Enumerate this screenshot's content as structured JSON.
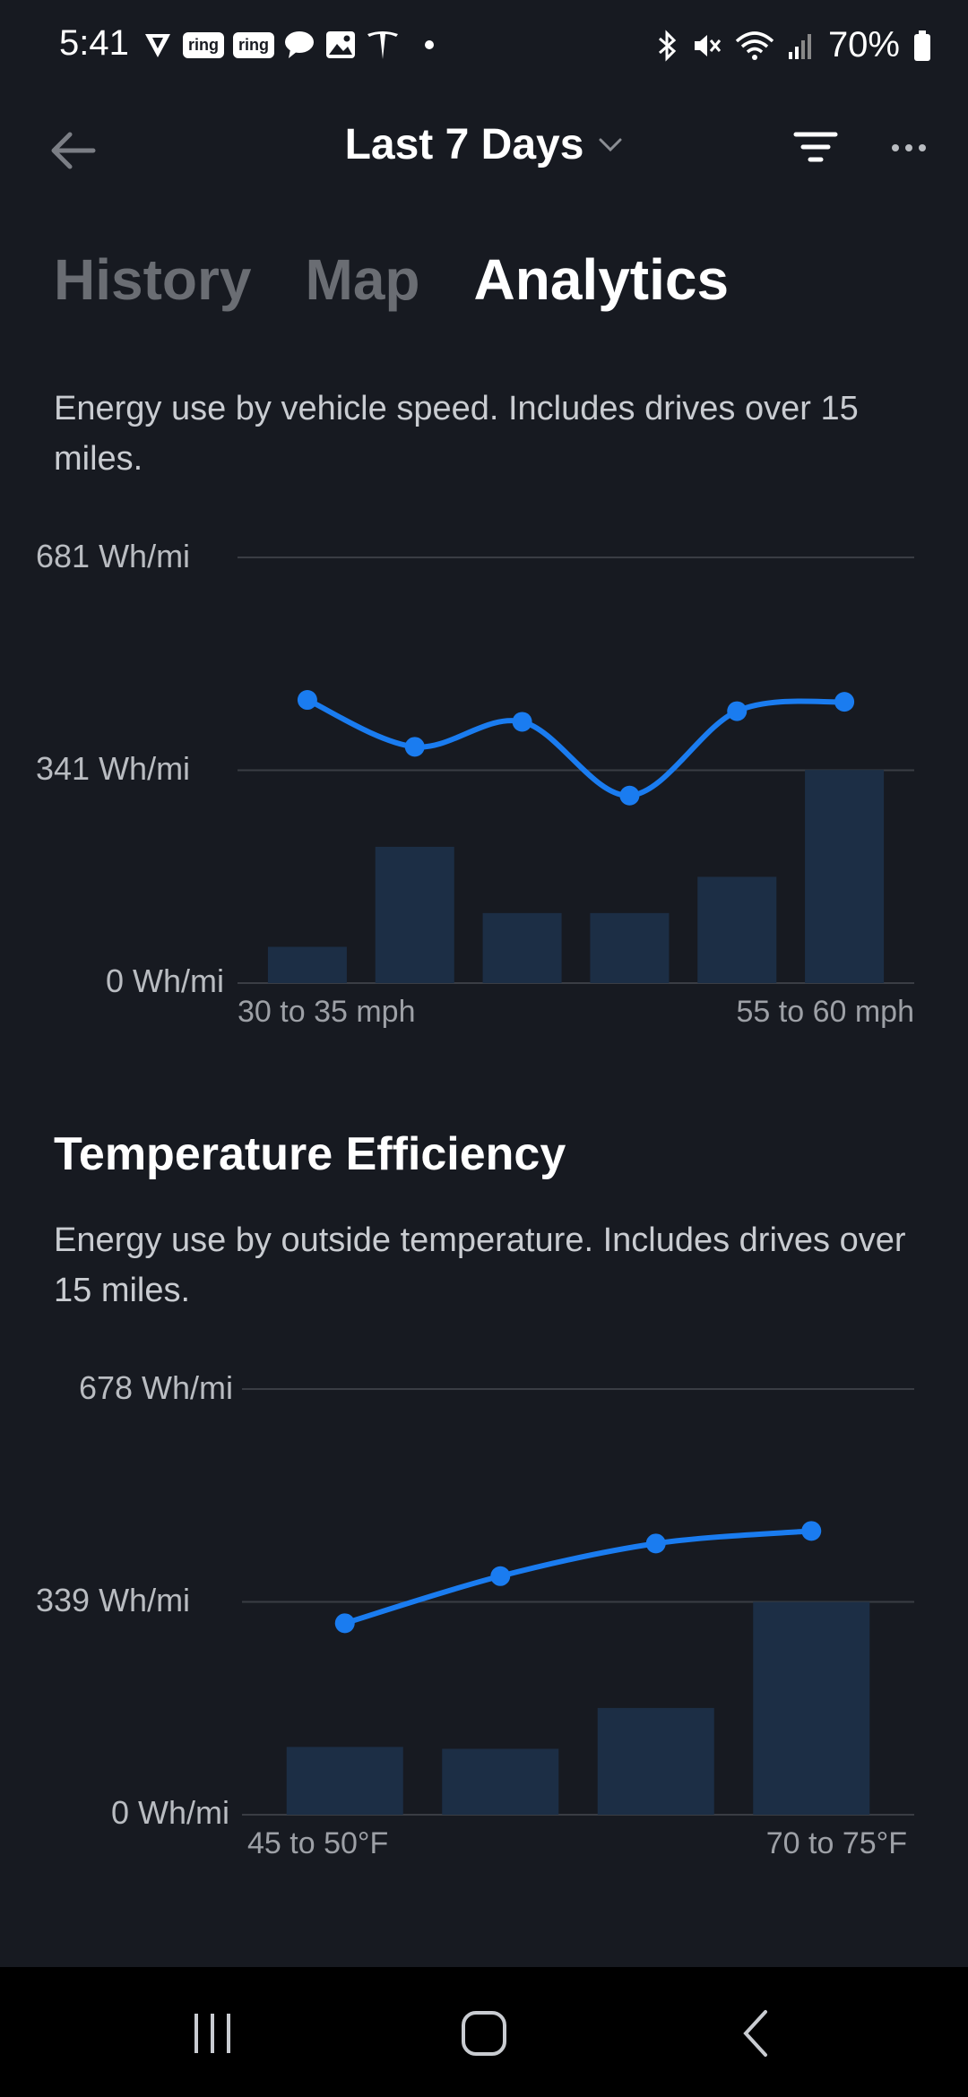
{
  "status_bar": {
    "time": "5:41",
    "left_icons": [
      "pinwheel-icon",
      "ring-icon",
      "ring-icon",
      "chat-bubble-icon",
      "image-icon",
      "tesla-icon"
    ],
    "ring_label": "ring",
    "battery": "70%",
    "right_icons": [
      "bluetooth-icon",
      "mute-icon",
      "wifi-icon",
      "signal-icon",
      "battery-icon"
    ]
  },
  "header": {
    "range_label": "Last 7 Days"
  },
  "tabs": [
    {
      "label": "History",
      "active": false
    },
    {
      "label": "Map",
      "active": false
    },
    {
      "label": "Analytics",
      "active": true
    }
  ],
  "speed_section": {
    "description": "Energy use by vehicle speed. Includes drives over 15 miles."
  },
  "temp_section": {
    "title": "Temperature Efficiency",
    "description": "Energy use by outside temperature. Includes drives over 15 miles."
  },
  "accent_color": "#1a7cf0",
  "bar_color": "#1c2e45",
  "chart_data": [
    {
      "type": "bar+line",
      "y_tick_labels": [
        "681 Wh/mi",
        "341 Wh/mi",
        "0 Wh/mi"
      ],
      "ylim": [
        0,
        681
      ],
      "x_tick_labels": [
        "30 to 35 mph",
        "55 to 60 mph"
      ],
      "categories": [
        "30 to 35 mph",
        "",
        "",
        "",
        "",
        "55 to 60 mph"
      ],
      "bars": [
        58,
        218,
        112,
        112,
        170,
        341
      ],
      "line": [
        453,
        378,
        418,
        300,
        435,
        450
      ],
      "grid": true
    },
    {
      "type": "bar+line",
      "y_tick_labels": [
        "678 Wh/mi",
        "339 Wh/mi",
        "0 Wh/mi"
      ],
      "ylim": [
        0,
        678
      ],
      "x_tick_labels": [
        "45 to 50°F",
        "70 to 75°F"
      ],
      "categories": [
        "45 to 50°F",
        "",
        "",
        "70 to 75°F"
      ],
      "bars": [
        108,
        105,
        170,
        339
      ],
      "line": [
        305,
        380,
        432,
        452
      ],
      "grid": true
    }
  ]
}
